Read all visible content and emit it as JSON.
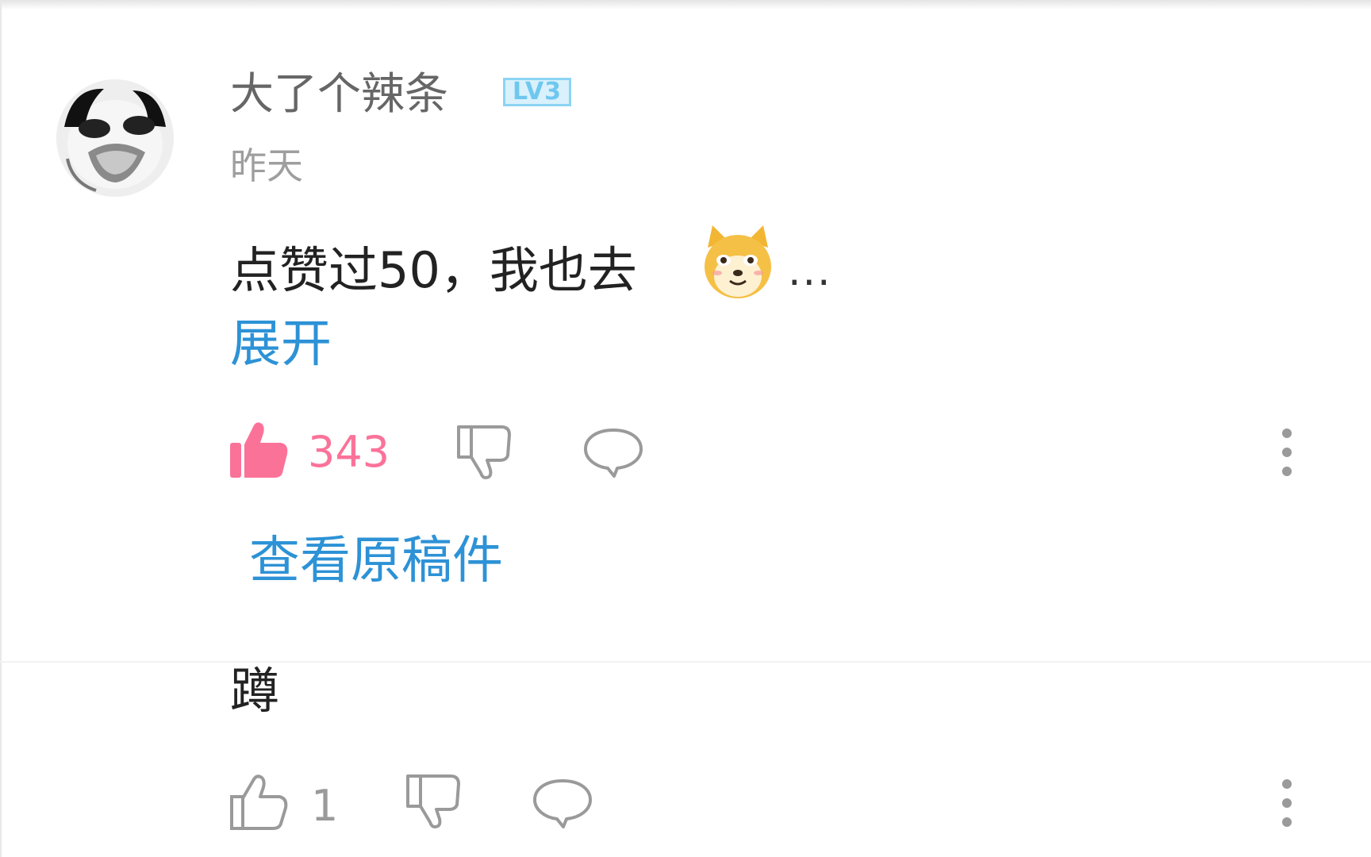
{
  "comment": {
    "username": "大了个辣条",
    "level_badge": "LV3",
    "timestamp": "昨天",
    "text": "点赞过50，我也去",
    "emoji": "doge-emoji",
    "ellipsis": "...",
    "expand_label": "展开",
    "like_count": "343",
    "liked": true,
    "view_original_label": "查看原稿件"
  },
  "reply": {
    "text": "蹲",
    "like_count": "1",
    "liked": false
  },
  "colors": {
    "liked_pink": "#fb7299",
    "link_blue": "#2d92d6",
    "icon_gray": "#9a9a9a",
    "badge_blue": "#6fc7ef"
  },
  "icons": [
    "thumbs-up-icon",
    "thumbs-down-icon",
    "comment-bubble-icon",
    "more-vertical-icon"
  ]
}
